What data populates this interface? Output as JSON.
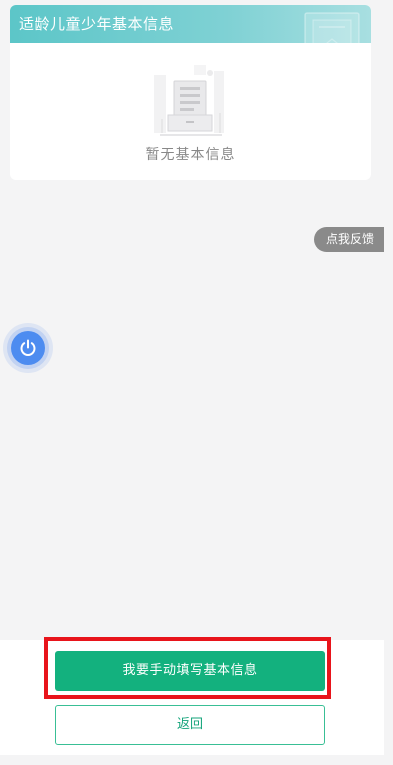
{
  "card": {
    "title": "适龄儿童少年基本信息",
    "empty_text": "暂无基本信息"
  },
  "feedback": {
    "label": "点我反馈"
  },
  "float_button": {
    "icon": "power-icon"
  },
  "actions": {
    "primary_label": "我要手动填写基本信息",
    "secondary_label": "返回"
  },
  "colors": {
    "header_gradient_start": "#5cc6c8",
    "primary_green": "#13b17e",
    "highlight_red": "#e8141b",
    "float_blue": "#4d8cf0",
    "feedback_gray": "#8a8a8a"
  }
}
